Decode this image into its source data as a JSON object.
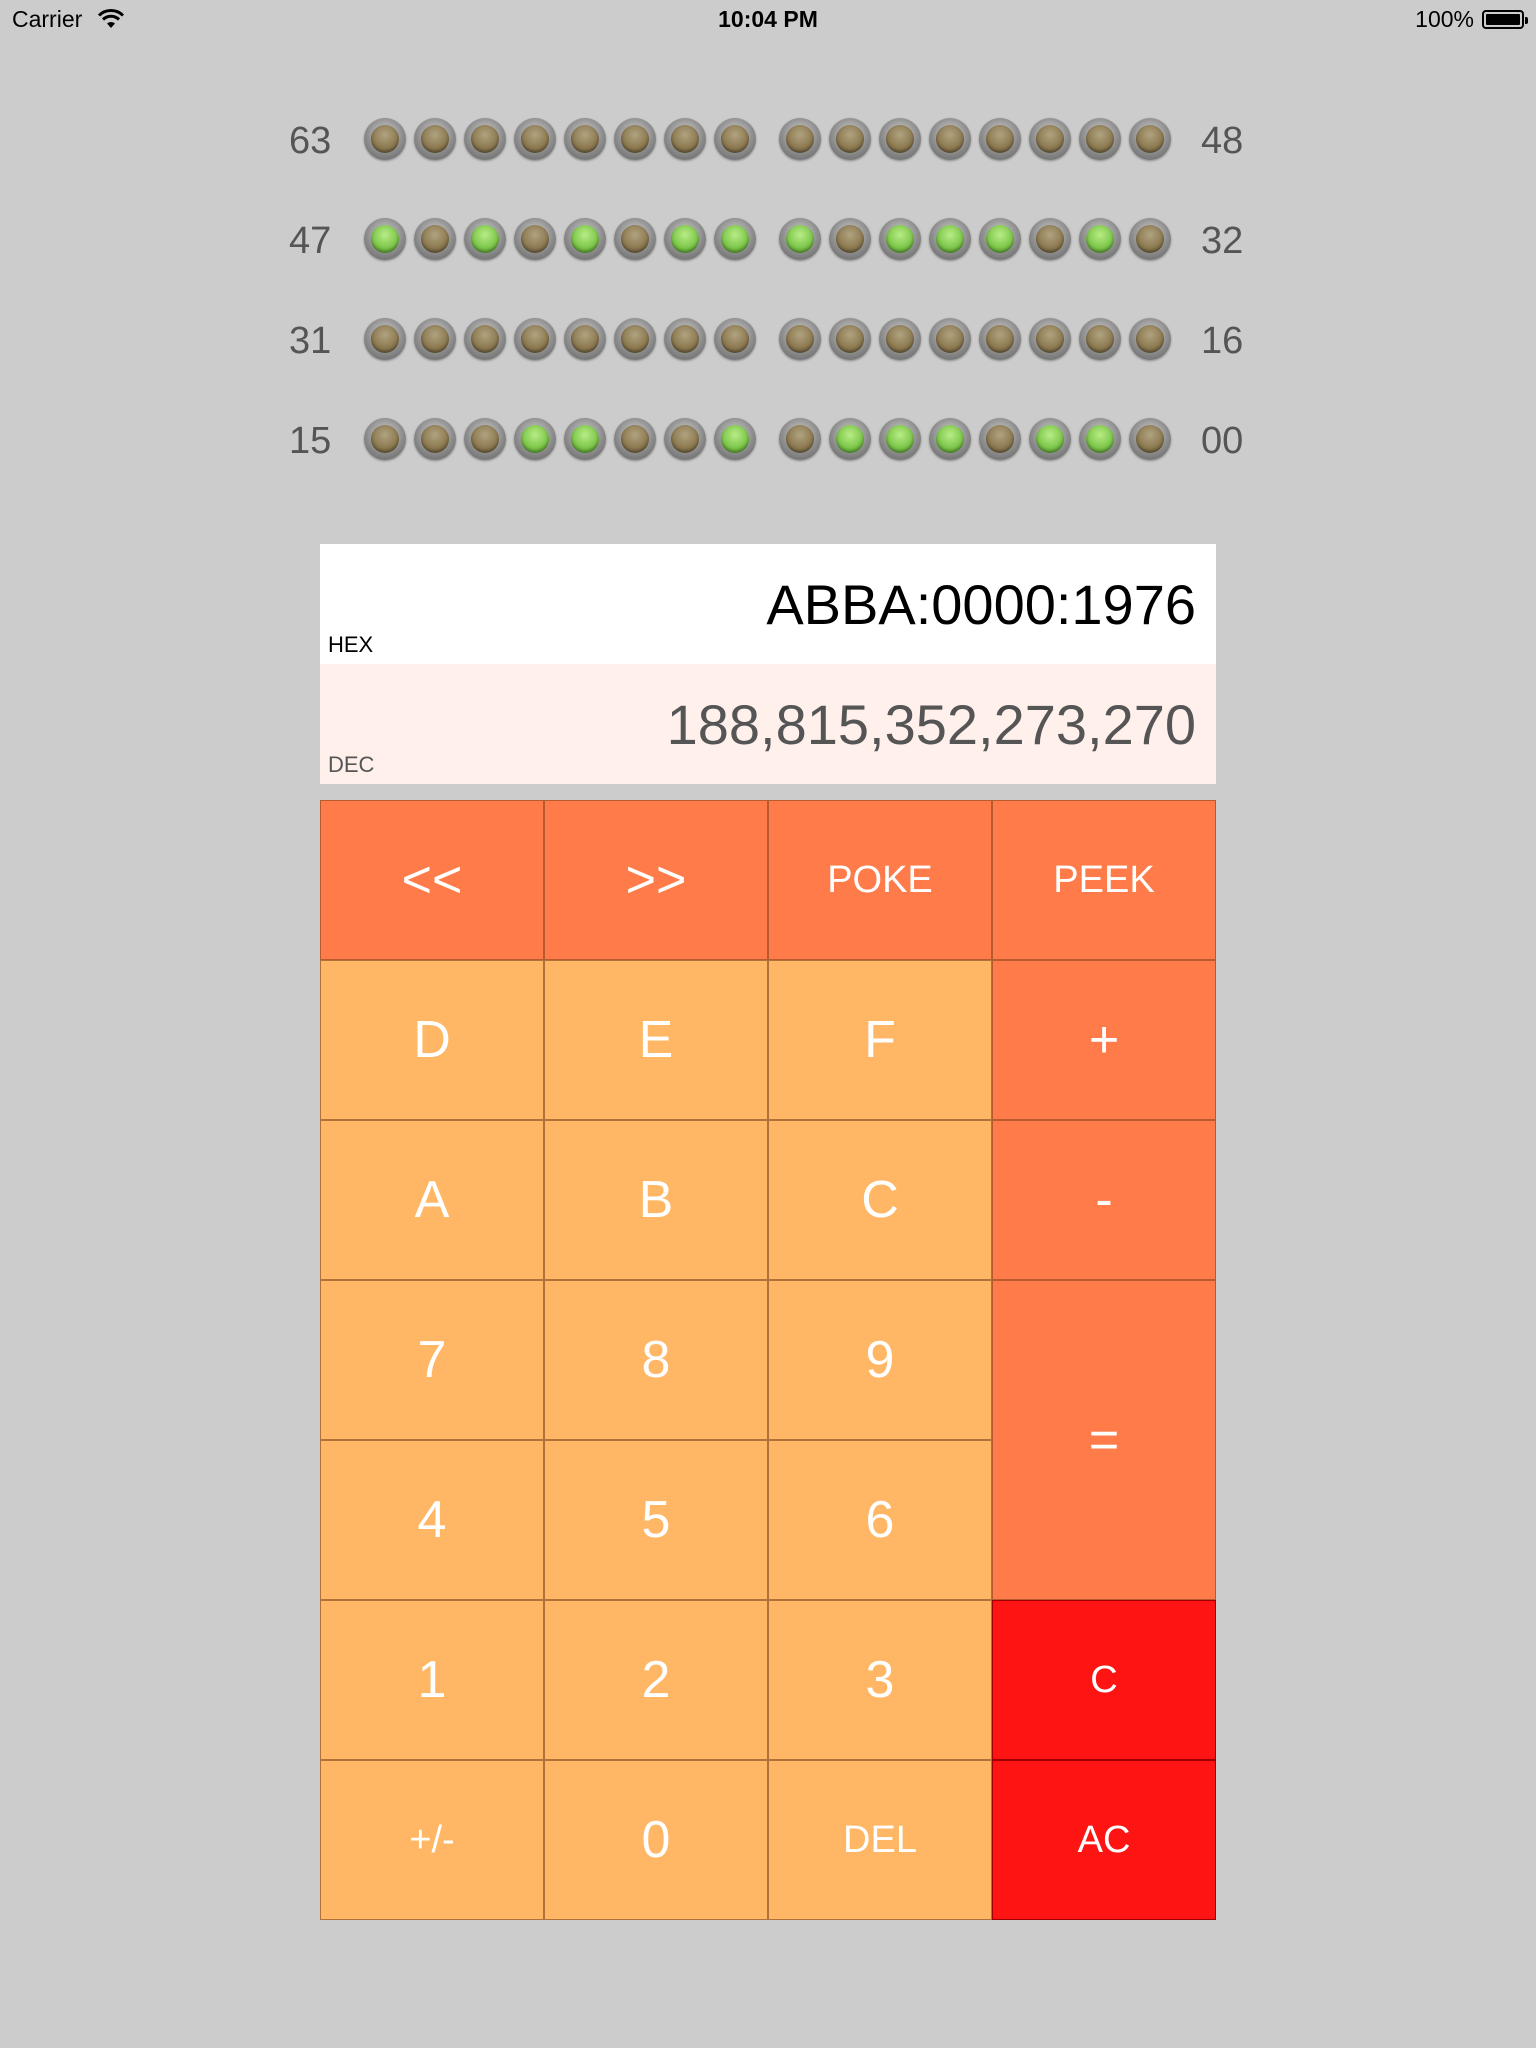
{
  "status_bar": {
    "carrier": "Carrier",
    "time": "10:04 PM",
    "battery": "100%"
  },
  "led_rows": [
    {
      "left_label": "63",
      "right_label": "48",
      "bits": [
        0,
        0,
        0,
        0,
        0,
        0,
        0,
        0,
        0,
        0,
        0,
        0,
        0,
        0,
        0,
        0
      ]
    },
    {
      "left_label": "47",
      "right_label": "32",
      "bits": [
        1,
        0,
        1,
        0,
        1,
        0,
        1,
        1,
        1,
        0,
        1,
        1,
        1,
        0,
        1,
        0
      ]
    },
    {
      "left_label": "31",
      "right_label": "16",
      "bits": [
        0,
        0,
        0,
        0,
        0,
        0,
        0,
        0,
        0,
        0,
        0,
        0,
        0,
        0,
        0,
        0
      ]
    },
    {
      "left_label": "15",
      "right_label": "00",
      "bits": [
        0,
        0,
        0,
        1,
        1,
        0,
        0,
        1,
        0,
        1,
        1,
        1,
        0,
        1,
        1,
        0
      ]
    }
  ],
  "display": {
    "hex_value": "ABBA:0000:1976",
    "hex_label": "HEX",
    "dec_value": "188,815,352,273,270",
    "dec_label": "DEC"
  },
  "keys": {
    "shift_left": "<<",
    "shift_right": ">>",
    "poke": "POKE",
    "peek": "PEEK",
    "d": "D",
    "e": "E",
    "f": "F",
    "plus": "+",
    "a": "A",
    "b": "B",
    "c_hex": "C",
    "minus": "-",
    "seven": "7",
    "eight": "8",
    "nine": "9",
    "equals": "=",
    "four": "4",
    "five": "5",
    "six": "6",
    "one": "1",
    "two": "2",
    "three": "3",
    "clear": "C",
    "negate": "+/-",
    "zero": "0",
    "delete": "DEL",
    "all_clear": "AC"
  },
  "colors": {
    "background": "#cccccc",
    "digit_key": "#ffb766",
    "operator_key": "#ff7c4a",
    "clear_key": "#ff1414",
    "led_on": "#7fc84c",
    "led_off": "#8e7b52"
  }
}
